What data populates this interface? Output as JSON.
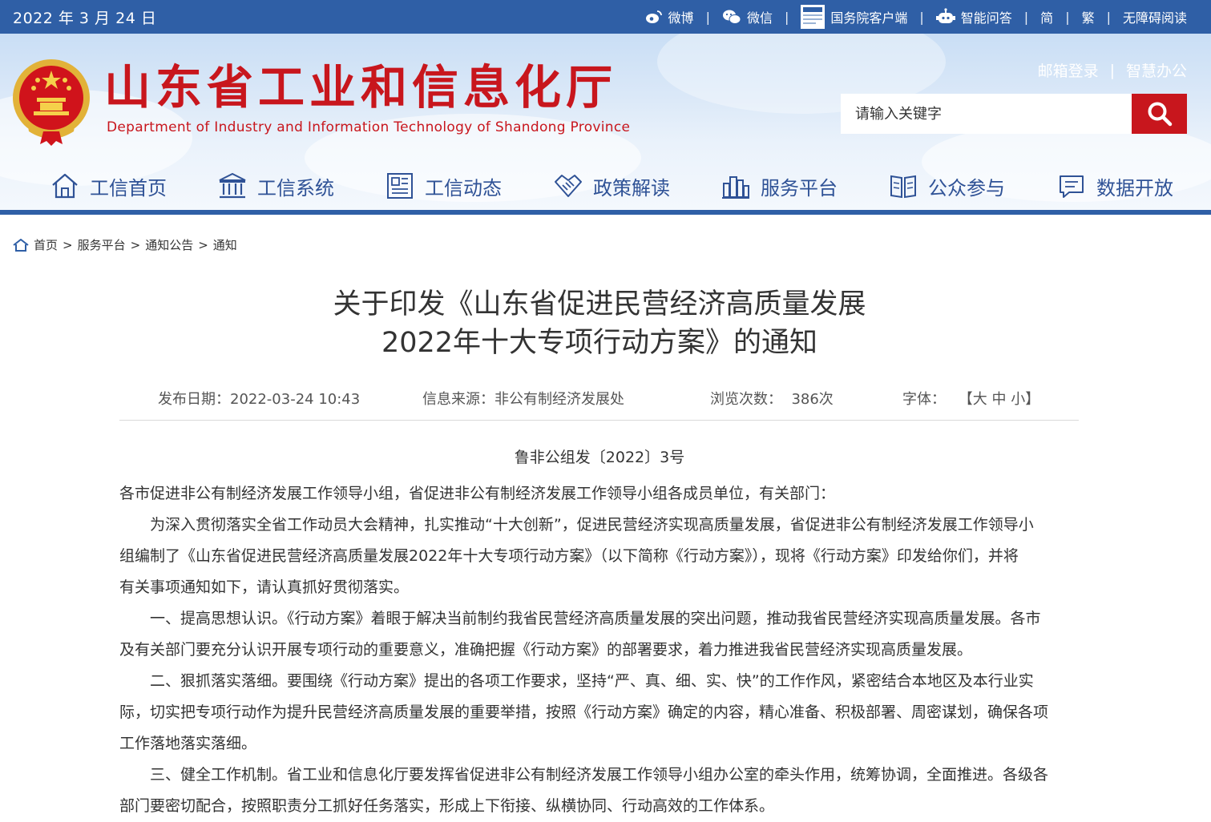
{
  "topbar": {
    "date": "2022 年 3 月 24 日",
    "links": [
      {
        "label": "微博",
        "icon": "weibo-icon"
      },
      {
        "label": "微信",
        "icon": "wechat-icon"
      },
      {
        "label": "国务院客户端",
        "icon": "state-council-app-icon"
      },
      {
        "label": "智能问答",
        "icon": "robot-icon"
      },
      {
        "label": "简"
      },
      {
        "label": "繁"
      },
      {
        "label": "无障碍阅读"
      }
    ],
    "separator": "|"
  },
  "header": {
    "title": "山东省工业和信息化厅",
    "subtitle": "Department of Industry and Information Technology of Shandong Province",
    "links": [
      "邮箱登录",
      "智慧办公"
    ],
    "search_placeholder": "请输入关键字"
  },
  "nav": [
    {
      "label": "工信首页",
      "icon": "home-icon"
    },
    {
      "label": "工信系统",
      "icon": "building-icon"
    },
    {
      "label": "工信动态",
      "icon": "news-icon"
    },
    {
      "label": "政策解读",
      "icon": "handshake-icon"
    },
    {
      "label": "服务平台",
      "icon": "city-icon"
    },
    {
      "label": "公众参与",
      "icon": "book-icon"
    },
    {
      "label": "数据开放",
      "icon": "chat-icon"
    }
  ],
  "breadcrumb": [
    "首页",
    "服务平台",
    "通知公告",
    "通知"
  ],
  "breadcrumb_sep": ">",
  "article": {
    "title_line1": "关于印发《山东省促进民营经济高质量发展",
    "title_line2": "2022年十大专项行动方案》的通知",
    "meta": {
      "date": "发布日期：2022-03-24 10:43",
      "source": "信息来源：非公有制经济发展处",
      "views": "浏览次数：  386次",
      "font_label": "字体：",
      "font_sizes": [
        "大",
        "中",
        "小"
      ]
    },
    "doc_no": "鲁非公组发〔2022〕3号",
    "lines": [
      "各市促进非公有制经济发展工作领导小组，省促进非公有制经济发展工作领导小组各成员单位，有关部门：",
      "为深入贯彻落实全省工作动员大会精神，扎实推动“十大创新”，促进民营经济实现高质量发展，省促进非公有制经济发展工作领导小",
      "组编制了《山东省促进民营经济高质量发展2022年十大专项行动方案》（以下简称《行动方案》），现将《行动方案》印发给你们，并将",
      "有关事项通知如下，请认真抓好贯彻落实。",
      "一、提高思想认识。《行动方案》着眼于解决当前制约我省民营经济高质量发展的突出问题，推动我省民营经济实现高质量发展。各市",
      "及有关部门要充分认识开展专项行动的重要意义，准确把握《行动方案》的部署要求，着力推进我省民营经济实现高质量发展。",
      "二、狠抓落实落细。要围绕《行动方案》提出的各项工作要求，坚持“严、真、细、实、快”的工作作风，紧密结合本地区及本行业实",
      "际，切实把专项行动作为提升民营经济高质量发展的重要举措，按照《行动方案》确定的内容，精心准备、积极部署、周密谋划，确保各项",
      "工作落地落实落细。",
      "三、健全工作机制。省工业和信息化厅要发挥省促进非公有制经济发展工作领导小组办公室的牵头作用，统筹协调，全面推进。各级各",
      "部门要密切配合，按照职责分工抓好任务落实，形成上下衔接、纵横协同、行动高效的工作体系。"
    ]
  },
  "colors": {
    "brand_blue": "#2f5fa6",
    "brand_red": "#c8161d",
    "nav_text": "#2f5296"
  }
}
